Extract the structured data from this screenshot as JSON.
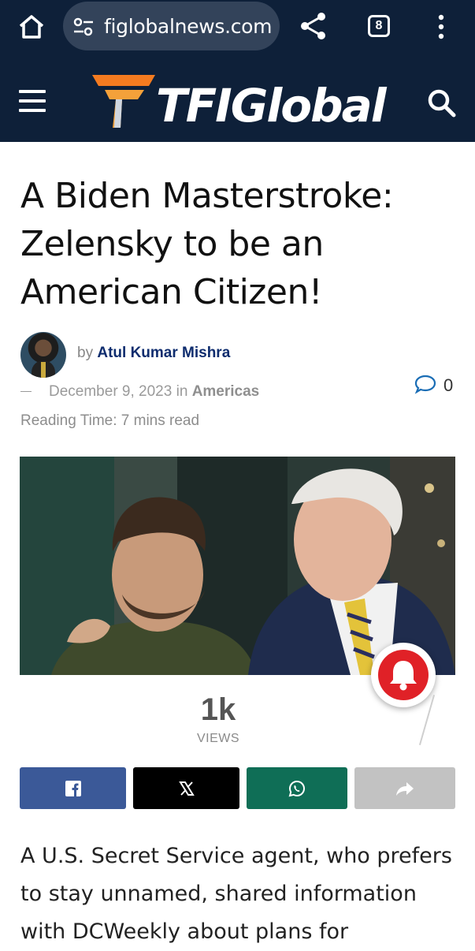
{
  "browser": {
    "url": "figlobalnews.com",
    "tab_count": "8",
    "icons": [
      "home-icon",
      "site-settings-icon",
      "share-icon",
      "tab-switcher-icon",
      "more-vert-icon"
    ]
  },
  "site": {
    "logo_text": "TFIGlobal",
    "icons": [
      "menu-icon",
      "logo-funnel-icon",
      "search-icon"
    ],
    "colors": {
      "header": "#0e2039",
      "logo_orange": "#f47b20",
      "author": "#0e2c6e"
    }
  },
  "article": {
    "headline": "A Biden Masterstroke: Zelensky to be an American Citizen!",
    "by": "by",
    "author": "Atul Kumar Mishra",
    "date": "December 9, 2023",
    "in": "in",
    "category": "Americas",
    "comment_count": "0",
    "reading_time": "Reading Time: 7 mins read",
    "views_count": "1k",
    "views_label": "VIEWS",
    "body": "A U.S. Secret Service agent, who prefers to stay unnamed, shared information with DCWeekly about plans for"
  },
  "share": {
    "buttons": [
      {
        "name": "facebook",
        "icon": "facebook-icon",
        "color": "#3b5998"
      },
      {
        "name": "x",
        "icon": "x-icon",
        "color": "#000000"
      },
      {
        "name": "whatsapp",
        "icon": "whatsapp-icon",
        "color": "#0f6e56"
      },
      {
        "name": "more",
        "icon": "forward-icon",
        "color": "#c2c2c2"
      }
    ]
  },
  "notification": {
    "icon": "bell-icon",
    "color": "#e02127"
  }
}
